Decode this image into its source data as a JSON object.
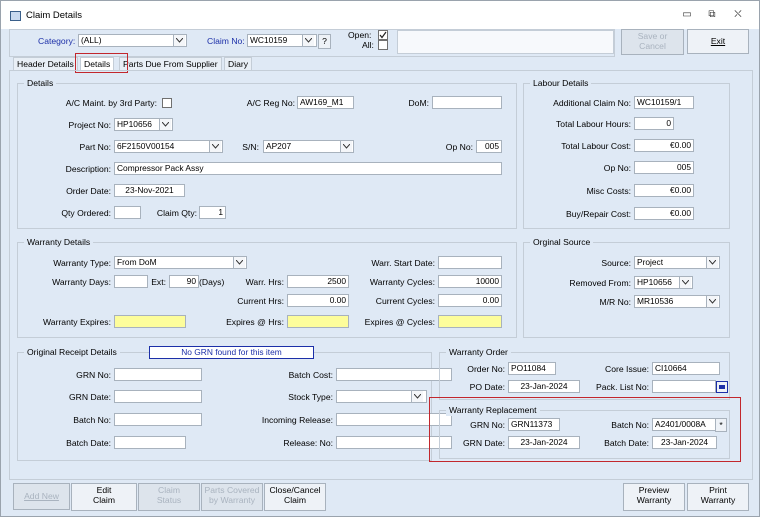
{
  "window": {
    "title": "Claim Details"
  },
  "window_controls": {
    "minimize": "▭",
    "restore": "⧉",
    "close": "⛌"
  },
  "topbar": {
    "category_label": "Category:",
    "category_value": "(ALL)",
    "claim_no_label": "Claim No:",
    "claim_no_value": "WC10159",
    "help_label": "?",
    "open_label": "Open:",
    "all_label": "All:",
    "save_label": "Save or\nCancel",
    "exit_label": "Exit"
  },
  "tabs": [
    "Header Details",
    "Details",
    "Parts Due From Supplier",
    "Diary"
  ],
  "details": {
    "title": "Details",
    "ac_maint_label": "A/C Maint. by 3rd Party:",
    "ac_reg_label": "A/C Reg No:",
    "ac_reg_value": "AW169_M1",
    "dom_label": "DoM:",
    "dom_value": "",
    "project_no_label": "Project No:",
    "project_no_value": "HP10656",
    "part_no_label": "Part No:",
    "part_no_value": "6F2150V00154",
    "sn_label": "S/N:",
    "sn_value": "AP207",
    "op_no_label": "Op No:",
    "op_no_value": "005",
    "description_label": "Description:",
    "description_value": "Compressor Pack Assy",
    "order_date_label": "Order Date:",
    "order_date_value": "23-Nov-2021",
    "qty_ordered_label": "Qty Ordered:",
    "qty_ordered_value": "",
    "claim_qty_label": "Claim Qty:",
    "claim_qty_value": "1"
  },
  "labour": {
    "title": "Labour Details",
    "additional_claim_label": "Additional Claim No:",
    "additional_claim_value": "WC10159/1",
    "total_hours_label": "Total Labour Hours:",
    "total_hours_value": "0",
    "total_cost_label": "Total Labour Cost:",
    "total_cost_value": "€0.00",
    "op_no_label": "Op No:",
    "op_no_value": "005",
    "misc_label": "Misc Costs:",
    "misc_value": "€0.00",
    "buy_repair_label": "Buy/Repair Cost:",
    "buy_repair_value": "€0.00"
  },
  "warranty": {
    "title": "Warranty Details",
    "type_label": "Warranty Type:",
    "type_value": "From DoM",
    "start_label": "Warr. Start Date:",
    "start_value": "",
    "days_label": "Warranty Days:",
    "days_value": "",
    "ext_label": "Ext:",
    "ext_value": "90",
    "days_unit": "(Days)",
    "hrs_label": "Warr. Hrs:",
    "hrs_value": "2500",
    "cycles_label": "Warranty Cycles:",
    "cycles_value": "10000",
    "current_hrs_label": "Current Hrs:",
    "current_hrs_value": "0.00",
    "current_cycles_label": "Current Cycles:",
    "current_cycles_value": "0.00",
    "expires_label": "Warranty Expires:",
    "expires_value": "",
    "expires_hrs_label": "Expires @ Hrs:",
    "expires_hrs_value": "",
    "expires_cycles_label": "Expires @ Cycles:",
    "expires_cycles_value": ""
  },
  "source": {
    "title": "Orginal Source",
    "source_label": "Source:",
    "source_value": "Project",
    "removed_label": "Removed From:",
    "removed_value": "HP10656",
    "mr_label": "M/R No:",
    "mr_value": "MR10536"
  },
  "receipt": {
    "title": "Original Receipt Details",
    "notice": "No GRN found for this item",
    "grn_no_label": "GRN No:",
    "grn_no_value": "",
    "batch_cost_label": "Batch Cost:",
    "batch_cost_value": "",
    "grn_date_label": "GRN Date:",
    "grn_date_value": "",
    "stock_type_label": "Stock Type:",
    "stock_type_value": "",
    "batch_no_label": "Batch No:",
    "batch_no_value": "",
    "incoming_label": "Incoming Release:",
    "incoming_value": "",
    "batch_date_label": "Batch Date:",
    "batch_date_value": "",
    "release_label": "Release: No:",
    "release_value": ""
  },
  "order": {
    "title": "Warranty Order",
    "order_no_label": "Order No:",
    "order_no_value": "PO11084",
    "core_label": "Core Issue:",
    "core_value": "CI10664",
    "po_date_label": "PO Date:",
    "po_date_value": "23-Jan-2024",
    "pack_label": "Pack. List No:",
    "pack_value": ""
  },
  "replacement": {
    "title": "Warranty Replacement",
    "grn_no_label": "GRN No:",
    "grn_no_value": "GRN11373",
    "batch_no_label": "Batch No:",
    "batch_no_value": "A2401/0008A",
    "batch_more": "*",
    "grn_date_label": "GRN Date:",
    "grn_date_value": "23-Jan-2024",
    "batch_date_label": "Batch Date:",
    "batch_date_value": "23-Jan-2024"
  },
  "bottom_buttons": {
    "add_new": "Add New",
    "edit_claim": "Edit\nClaim",
    "claim_status": "Claim\nStatus",
    "parts_covered": "Parts Covered\nby Warranty",
    "close_cancel": "Close/Cancel\nClaim",
    "preview": "Preview\nWarranty",
    "print": "Print\nWarranty"
  },
  "colors": {
    "accent_blue": "#1c2fa8",
    "highlight_red": "#c2272d",
    "yellow_field": "#fdfd9b"
  }
}
